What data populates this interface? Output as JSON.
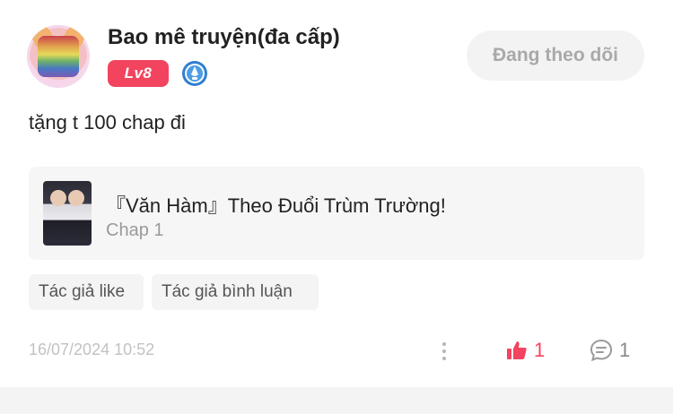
{
  "user": {
    "name": "Bao mê truyện(đa cấp)",
    "level": "Lv8",
    "follow_label": "Đang theo dõi"
  },
  "comment": {
    "text": "tặng t 100 chap đi"
  },
  "chapter": {
    "title": "『Văn Hàm』Theo Đuổi Trùm Trường!",
    "subtitle": "Chap 1"
  },
  "tags": [
    "Tác giả like",
    "Tác giả bình luận"
  ],
  "meta": {
    "timestamp": "16/07/2024 10:52",
    "likes": "1",
    "replies": "1"
  },
  "colors": {
    "accent": "#f2445f",
    "muted": "#a9a9a9"
  }
}
